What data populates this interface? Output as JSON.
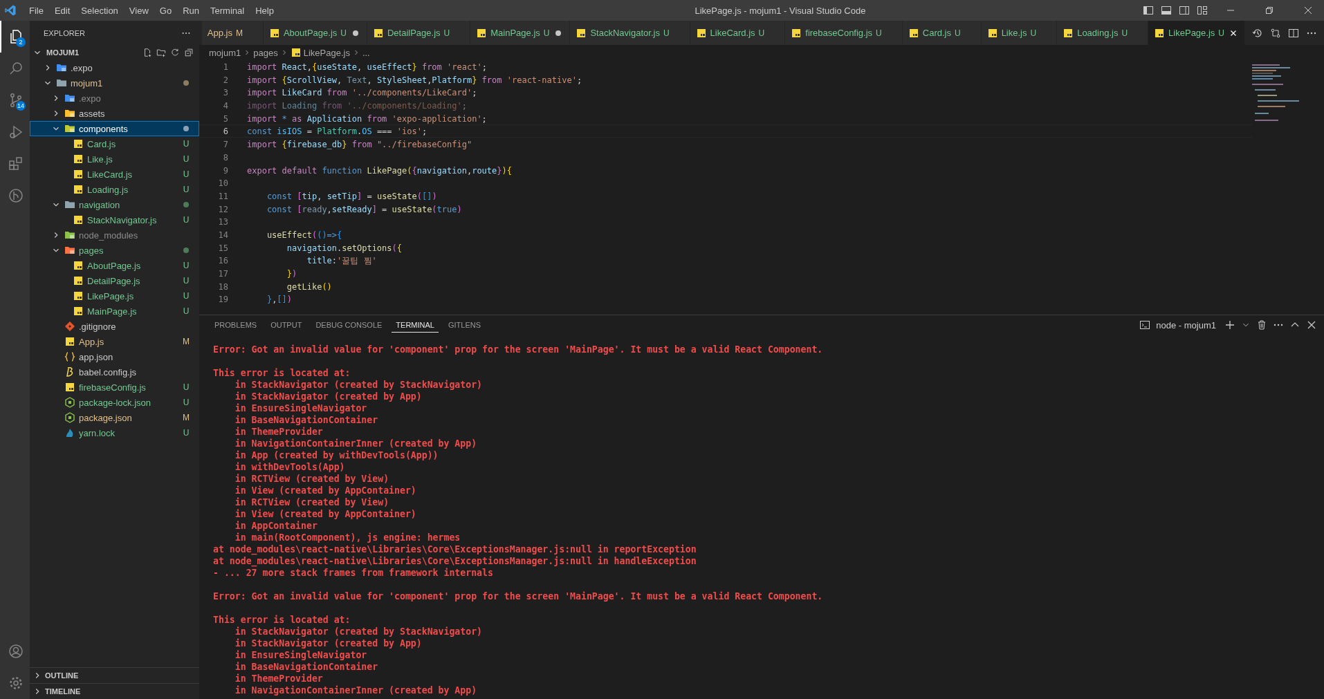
{
  "title_bar": {
    "menu": [
      "File",
      "Edit",
      "Selection",
      "View",
      "Go",
      "Run",
      "Terminal",
      "Help"
    ],
    "title": "LikePage.js - mojum1 - Visual Studio Code"
  },
  "activity_bar": {
    "items": [
      {
        "kind": "files",
        "badge": "2",
        "selected": true
      },
      {
        "kind": "search",
        "selected": false
      },
      {
        "kind": "source-control",
        "badge": "14",
        "selected": false
      },
      {
        "kind": "run",
        "selected": false
      },
      {
        "kind": "extensions",
        "selected": false
      },
      {
        "kind": "branch",
        "selected": false
      }
    ],
    "bottom": [
      {
        "kind": "account"
      },
      {
        "kind": "settings"
      }
    ]
  },
  "sidebar": {
    "title": "EXPLORER",
    "root": "MOJUM1",
    "tree": [
      {
        "label": ".expo",
        "kind": "folder-expo",
        "expanded": false,
        "selected": false
      },
      {
        "label": "mojum1",
        "kind": "folder",
        "expanded": true,
        "selected": false,
        "color": "#e2c08d",
        "dot": {
          "color": "#8a7b61"
        },
        "children": [
          {
            "label": ".expo",
            "kind": "folder-expo",
            "expanded": false,
            "selected": false,
            "color": "#8c8c8c"
          },
          {
            "label": "assets",
            "kind": "folder-assets",
            "expanded": false,
            "selected": false
          },
          {
            "label": "components",
            "kind": "folder-components",
            "expanded": true,
            "selected": true,
            "dot": {
              "color": "#8aa1b4"
            },
            "children": [
              {
                "label": "Card.js",
                "kind": "js",
                "selected": false,
                "color": "#73c991",
                "badge": "U"
              },
              {
                "label": "Like.js",
                "kind": "js",
                "selected": false,
                "color": "#73c991",
                "badge": "U"
              },
              {
                "label": "LikeCard.js",
                "kind": "js",
                "selected": false,
                "color": "#73c991",
                "badge": "U"
              },
              {
                "label": "Loading.js",
                "kind": "js",
                "selected": false,
                "color": "#73c991",
                "badge": "U"
              }
            ]
          },
          {
            "label": "navigation",
            "kind": "folder",
            "expanded": true,
            "selected": false,
            "color": "#73c991",
            "dot": {
              "color": "#4e7a57"
            },
            "children": [
              {
                "label": "StackNavigator.js",
                "kind": "js",
                "selected": false,
                "color": "#73c991",
                "badge": "U"
              }
            ]
          },
          {
            "label": "node_modules",
            "kind": "folder-node",
            "expanded": false,
            "selected": false,
            "color": "#8c8c8c"
          },
          {
            "label": "pages",
            "kind": "folder-pages",
            "expanded": true,
            "selected": false,
            "color": "#73c991",
            "dot": {
              "color": "#4e7a57"
            },
            "children": [
              {
                "label": "AboutPage.js",
                "kind": "js",
                "selected": false,
                "color": "#73c991",
                "badge": "U"
              },
              {
                "label": "DetailPage.js",
                "kind": "js",
                "selected": false,
                "color": "#73c991",
                "badge": "U"
              },
              {
                "label": "LikePage.js",
                "kind": "js",
                "selected": false,
                "color": "#73c991",
                "badge": "U"
              },
              {
                "label": "MainPage.js",
                "kind": "js",
                "selected": false,
                "color": "#73c991",
                "badge": "U"
              }
            ]
          },
          {
            "label": ".gitignore",
            "kind": "git",
            "selected": false
          },
          {
            "label": "App.js",
            "kind": "js",
            "selected": false,
            "color": "#e2c08d",
            "badge": "M"
          },
          {
            "label": "app.json",
            "kind": "json",
            "selected": false
          },
          {
            "label": "babel.config.js",
            "kind": "babel",
            "selected": false
          },
          {
            "label": "firebaseConfig.js",
            "kind": "js",
            "selected": false,
            "color": "#73c991",
            "badge": "U"
          },
          {
            "label": "package-lock.json",
            "kind": "nodejs",
            "selected": false,
            "color": "#73c991",
            "badge": "U"
          },
          {
            "label": "package.json",
            "kind": "nodejs",
            "selected": false,
            "color": "#e2c08d",
            "badge": "M"
          },
          {
            "label": "yarn.lock",
            "kind": "yarn",
            "selected": false,
            "color": "#73c991",
            "badge": "U"
          }
        ]
      }
    ],
    "sections": [
      {
        "label": "OUTLINE",
        "expanded": false
      },
      {
        "label": "TIMELINE",
        "expanded": false
      }
    ]
  },
  "tabs": [
    {
      "label": "App.js",
      "badge": "M",
      "color": "#e2c08d",
      "dirty": false,
      "selected": false
    },
    {
      "label": "AboutPage.js",
      "kind": "js",
      "badge": "U",
      "color": "#73c991",
      "dirty": true,
      "selected": false
    },
    {
      "label": "DetailPage.js",
      "kind": "js",
      "badge": "U",
      "color": "#73c991",
      "dirty": false,
      "selected": false
    },
    {
      "label": "MainPage.js",
      "kind": "js",
      "badge": "U",
      "color": "#73c991",
      "dirty": true,
      "selected": false
    },
    {
      "label": "StackNavigator.js",
      "kind": "js",
      "badge": "U",
      "color": "#73c991",
      "dirty": false,
      "selected": false
    },
    {
      "label": "LikeCard.js",
      "kind": "js",
      "badge": "U",
      "color": "#73c991",
      "dirty": false,
      "selected": false
    },
    {
      "label": "firebaseConfig.js",
      "kind": "js",
      "badge": "U",
      "color": "#73c991",
      "dirty": false,
      "selected": false
    },
    {
      "label": "Card.js",
      "kind": "js",
      "badge": "U",
      "color": "#73c991",
      "dirty": false,
      "selected": false
    },
    {
      "label": "Like.js",
      "kind": "js",
      "badge": "U",
      "color": "#73c991",
      "dirty": false,
      "selected": false
    },
    {
      "label": "Loading.js",
      "kind": "js",
      "badge": "U",
      "color": "#73c991",
      "dirty": false,
      "selected": false
    },
    {
      "label": "LikePage.js",
      "kind": "js",
      "badge": "U",
      "color": "#73c991",
      "dirty": false,
      "selected": true
    }
  ],
  "breadcrumb": [
    {
      "label": "mojum1"
    },
    {
      "label": "pages"
    },
    {
      "label": "LikePage.js",
      "kind": "js"
    },
    {
      "label": "..."
    }
  ],
  "editor": {
    "lines": [
      {
        "number": "1",
        "current": false,
        "faded": false,
        "tokens": [
          {
            "kind": "keyword",
            "text": "import "
          },
          {
            "kind": "variable",
            "text": "React"
          },
          {
            "kind": "plain",
            "text": ","
          },
          {
            "kind": "bracket1",
            "text": "{"
          },
          {
            "kind": "variable",
            "text": "useState"
          },
          {
            "kind": "plain",
            "text": ", "
          },
          {
            "kind": "variable",
            "text": "useEffect"
          },
          {
            "kind": "bracket1",
            "text": "}"
          },
          {
            "kind": "keyword",
            "text": " from "
          },
          {
            "kind": "string",
            "text": "'react'"
          },
          {
            "kind": "plain",
            "text": ";"
          }
        ]
      },
      {
        "number": "2",
        "current": false,
        "faded": false,
        "tokens": [
          {
            "kind": "keyword",
            "text": "import "
          },
          {
            "kind": "bracket1",
            "text": "{"
          },
          {
            "kind": "variable",
            "text": "ScrollView"
          },
          {
            "kind": "plain",
            "text": ", "
          },
          {
            "kind": "unused",
            "text": "Text"
          },
          {
            "kind": "plain",
            "text": ", "
          },
          {
            "kind": "variable",
            "text": "StyleSheet"
          },
          {
            "kind": "plain",
            "text": ","
          },
          {
            "kind": "variable",
            "text": "Platform"
          },
          {
            "kind": "bracket1",
            "text": "}"
          },
          {
            "kind": "keyword",
            "text": " from "
          },
          {
            "kind": "string",
            "text": "'react-native'"
          },
          {
            "kind": "plain",
            "text": ";"
          }
        ]
      },
      {
        "number": "3",
        "current": false,
        "faded": false,
        "tokens": [
          {
            "kind": "keyword",
            "text": "import "
          },
          {
            "kind": "variable",
            "text": "LikeCard"
          },
          {
            "kind": "keyword",
            "text": " from "
          },
          {
            "kind": "string",
            "text": "'../components/LikeCard'"
          },
          {
            "kind": "plain",
            "text": ";"
          }
        ]
      },
      {
        "number": "4",
        "current": false,
        "faded": true,
        "tokens": [
          {
            "kind": "keyword",
            "text": "import "
          },
          {
            "kind": "variable",
            "text": "Loading"
          },
          {
            "kind": "keyword",
            "text": " from "
          },
          {
            "kind": "string",
            "text": "'../components/Loading'"
          },
          {
            "kind": "plain",
            "text": ";"
          }
        ]
      },
      {
        "number": "5",
        "current": false,
        "faded": false,
        "tokens": [
          {
            "kind": "keyword",
            "text": "import "
          },
          {
            "kind": "declaration",
            "text": "*"
          },
          {
            "kind": "keyword",
            "text": " as "
          },
          {
            "kind": "variable",
            "text": "Application"
          },
          {
            "kind": "keyword",
            "text": " from "
          },
          {
            "kind": "string",
            "text": "'expo-application'"
          },
          {
            "kind": "plain",
            "text": ";"
          }
        ]
      },
      {
        "number": "6",
        "current": true,
        "faded": false,
        "tokens": [
          {
            "kind": "declaration",
            "text": "const "
          },
          {
            "kind": "constant",
            "text": "isIOS"
          },
          {
            "kind": "plain",
            "text": " = "
          },
          {
            "kind": "type",
            "text": "Platform"
          },
          {
            "kind": "plain",
            "text": "."
          },
          {
            "kind": "constant",
            "text": "OS"
          },
          {
            "kind": "plain",
            "text": " === "
          },
          {
            "kind": "string",
            "text": "'ios'"
          },
          {
            "kind": "plain",
            "text": ";"
          }
        ]
      },
      {
        "number": "7",
        "current": false,
        "faded": false,
        "tokens": [
          {
            "kind": "keyword",
            "text": "import "
          },
          {
            "kind": "bracket1",
            "text": "{"
          },
          {
            "kind": "variable",
            "text": "firebase_db"
          },
          {
            "kind": "bracket1",
            "text": "}"
          },
          {
            "kind": "keyword",
            "text": " from "
          },
          {
            "kind": "string",
            "text": "\"../firebaseConfig\""
          }
        ]
      },
      {
        "number": "8",
        "current": false
      },
      {
        "number": "9",
        "current": false,
        "faded": false,
        "tokens": [
          {
            "kind": "keyword",
            "text": "export default "
          },
          {
            "kind": "declaration",
            "text": "function "
          },
          {
            "kind": "function",
            "text": "LikePage"
          },
          {
            "kind": "bracket1",
            "text": "("
          },
          {
            "kind": "bracket2",
            "text": "{"
          },
          {
            "kind": "variable",
            "text": "navigation"
          },
          {
            "kind": "plain",
            "text": ","
          },
          {
            "kind": "variable",
            "text": "route"
          },
          {
            "kind": "bracket2",
            "text": "}"
          },
          {
            "kind": "bracket1",
            "text": "){"
          }
        ]
      },
      {
        "number": "10",
        "current": false
      },
      {
        "number": "11",
        "current": false,
        "faded": false,
        "tokens": [
          {
            "kind": "declaration",
            "text": "    const "
          },
          {
            "kind": "bracket2",
            "text": "["
          },
          {
            "kind": "variable",
            "text": "tip"
          },
          {
            "kind": "plain",
            "text": ", "
          },
          {
            "kind": "variable",
            "text": "setTip"
          },
          {
            "kind": "bracket2",
            "text": "]"
          },
          {
            "kind": "plain",
            "text": " = "
          },
          {
            "kind": "function",
            "text": "useState"
          },
          {
            "kind": "bracket2",
            "text": "("
          },
          {
            "kind": "bracket3",
            "text": "[]"
          },
          {
            "kind": "bracket2",
            "text": ")"
          }
        ]
      },
      {
        "number": "12",
        "current": false,
        "faded": false,
        "tokens": [
          {
            "kind": "declaration",
            "text": "    const "
          },
          {
            "kind": "bracket2",
            "text": "["
          },
          {
            "kind": "unused",
            "text": "ready"
          },
          {
            "kind": "plain",
            "text": ","
          },
          {
            "kind": "variable",
            "text": "setReady"
          },
          {
            "kind": "bracket2",
            "text": "]"
          },
          {
            "kind": "plain",
            "text": " = "
          },
          {
            "kind": "function",
            "text": "useState"
          },
          {
            "kind": "bracket2",
            "text": "("
          },
          {
            "kind": "declaration",
            "text": "true"
          },
          {
            "kind": "bracket2",
            "text": ")"
          }
        ]
      },
      {
        "number": "13",
        "current": false
      },
      {
        "number": "14",
        "current": false,
        "faded": false,
        "tokens": [
          {
            "kind": "function",
            "text": "    useEffect"
          },
          {
            "kind": "bracket2",
            "text": "("
          },
          {
            "kind": "bracket3",
            "text": "()"
          },
          {
            "kind": "declaration",
            "text": "=>"
          },
          {
            "kind": "bracket3",
            "text": "{"
          }
        ]
      },
      {
        "number": "15",
        "current": false,
        "faded": false,
        "tokens": [
          {
            "kind": "variable",
            "text": "        navigation"
          },
          {
            "kind": "plain",
            "text": "."
          },
          {
            "kind": "function",
            "text": "setOptions"
          },
          {
            "kind": "bracket2",
            "text": "("
          },
          {
            "kind": "bracket1",
            "text": "{"
          }
        ]
      },
      {
        "number": "16",
        "current": false,
        "faded": false,
        "tokens": [
          {
            "kind": "variable",
            "text": "            title"
          },
          {
            "kind": "plain",
            "text": ":"
          },
          {
            "kind": "string",
            "text": "'꿀팁 찜'"
          }
        ]
      },
      {
        "number": "17",
        "current": false,
        "faded": false,
        "tokens": [
          {
            "kind": "bracket1",
            "text": "        }"
          },
          {
            "kind": "bracket2",
            "text": ")"
          }
        ]
      },
      {
        "number": "18",
        "current": false,
        "faded": false,
        "tokens": [
          {
            "kind": "function",
            "text": "        getLike"
          },
          {
            "kind": "bracket1",
            "text": "()"
          }
        ]
      },
      {
        "number": "19",
        "current": false,
        "faded": false,
        "tokens": [
          {
            "kind": "bracket3",
            "text": "    }"
          },
          {
            "kind": "plain",
            "text": ","
          },
          {
            "kind": "bracket3",
            "text": "[]"
          },
          {
            "kind": "bracket2",
            "text": ")"
          }
        ]
      }
    ]
  },
  "panel": {
    "tabs": [
      {
        "label": "PROBLEMS",
        "selected": false
      },
      {
        "label": "OUTPUT",
        "selected": false
      },
      {
        "label": "DEBUG CONSOLE",
        "selected": false
      },
      {
        "label": "TERMINAL",
        "selected": true
      },
      {
        "label": "GITLENS",
        "selected": false
      }
    ],
    "terminal_name": "node - mojum1",
    "output": [
      [
        "Error: Got an invalid value for 'component' prop for the screen 'MainPage'. It must be a valid React Component."
      ],
      [
        "This error is located at:",
        "    in StackNavigator (created by StackNavigator)",
        "    in StackNavigator (created by App)",
        "    in EnsureSingleNavigator",
        "    in BaseNavigationContainer",
        "    in ThemeProvider",
        "    in NavigationContainerInner (created by App)",
        "    in App (created by withDevTools(App))",
        "    in withDevTools(App)",
        "    in RCTView (created by View)",
        "    in View (created by AppContainer)",
        "    in RCTView (created by View)",
        "    in View (created by AppContainer)",
        "    in AppContainer",
        "    in main(RootComponent), js engine: hermes",
        "at node_modules\\react-native\\Libraries\\Core\\ExceptionsManager.js:null in reportException",
        "at node_modules\\react-native\\Libraries\\Core\\ExceptionsManager.js:null in handleException",
        "- ... 27 more stack frames from framework internals"
      ],
      [
        "Error: Got an invalid value for 'component' prop for the screen 'MainPage'. It must be a valid React Component."
      ],
      [
        "This error is located at:",
        "    in StackNavigator (created by StackNavigator)",
        "    in StackNavigator (created by App)",
        "    in EnsureSingleNavigator",
        "    in BaseNavigationContainer",
        "    in ThemeProvider",
        "    in NavigationContainerInner (created by App)"
      ]
    ]
  }
}
